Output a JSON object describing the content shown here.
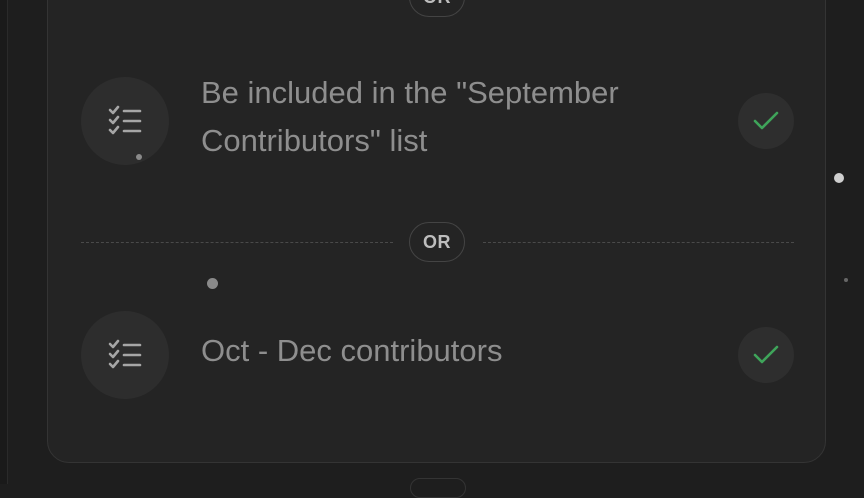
{
  "separators": {
    "top_label": "OR",
    "middle_label": "OR"
  },
  "requirements": [
    {
      "icon": "checklist-icon",
      "text": "Be included in the \"September Contributors\" list",
      "status": "completed",
      "status_icon": "check-icon"
    },
    {
      "icon": "checklist-icon",
      "text": "Oct - Dec contributors",
      "status": "completed",
      "status_icon": "check-icon"
    }
  ],
  "colors": {
    "background": "#1e1e1e",
    "card": "#242424",
    "text_muted": "#8e8e8e",
    "check_green": "#3fa45a"
  }
}
